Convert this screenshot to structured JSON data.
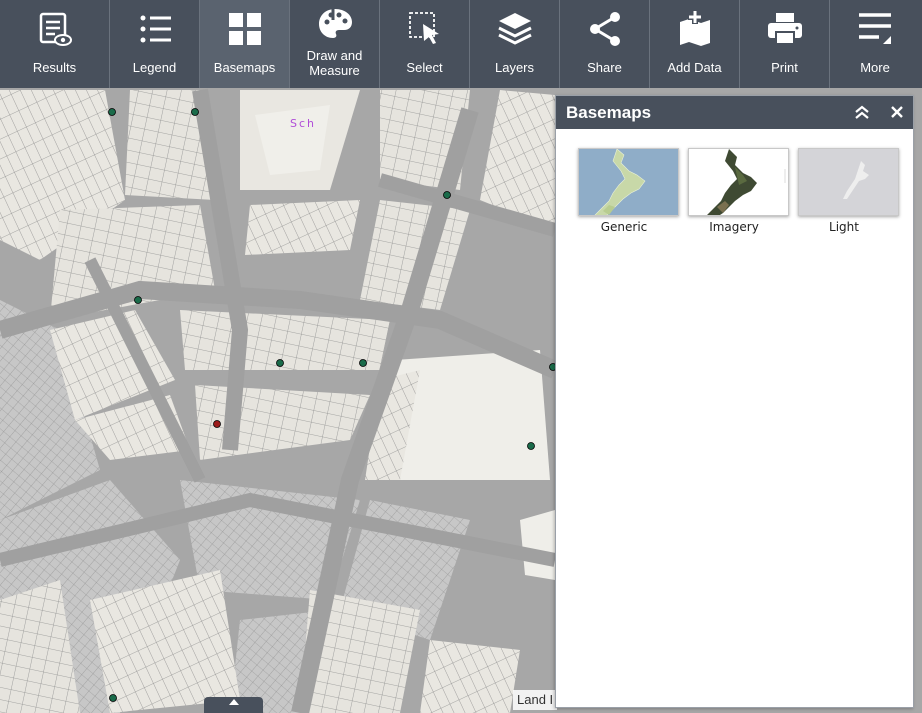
{
  "toolbar": {
    "items": [
      {
        "label": "Results",
        "icon": "results-icon"
      },
      {
        "label": "Legend",
        "icon": "legend-icon"
      },
      {
        "label": "Basemaps",
        "icon": "basemaps-icon",
        "active": true
      },
      {
        "label_line1": "Draw and",
        "label_line2": "Measure",
        "icon": "palette-icon"
      },
      {
        "label": "Select",
        "icon": "select-icon"
      },
      {
        "label": "Layers",
        "icon": "layers-icon"
      },
      {
        "label": "Share",
        "icon": "share-icon"
      },
      {
        "label": "Add Data",
        "icon": "add-data-icon"
      },
      {
        "label": "Print",
        "icon": "printer-icon"
      },
      {
        "label": "More",
        "icon": "more-icon"
      }
    ],
    "colors": {
      "background": "#48505c",
      "active": "#5a636f",
      "text": "#ffffff"
    }
  },
  "panel": {
    "title": "Basemaps",
    "collapse_icon": "double-chevron-up-icon",
    "close_icon": "close-icon",
    "basemaps": [
      {
        "label": "Generic",
        "thumbnail": "nz-generic-map",
        "bg": "#8fadc8",
        "land": "#c8d8a8"
      },
      {
        "label": "Imagery",
        "thumbnail": "nz-satellite",
        "bg": "#ffffff",
        "land": "#3f4a33"
      },
      {
        "label": "Light",
        "thumbnail": "nz-light-map",
        "bg": "#d4d4d8",
        "land": "#eeeeee"
      }
    ]
  },
  "map": {
    "label": "Sch",
    "attribution": "Land I",
    "colors": {
      "roads": "#a7a7a7",
      "parcels": "#e9e7e1",
      "green_marker": "#1a6b4a",
      "red_marker": "#9b1b1b"
    }
  }
}
